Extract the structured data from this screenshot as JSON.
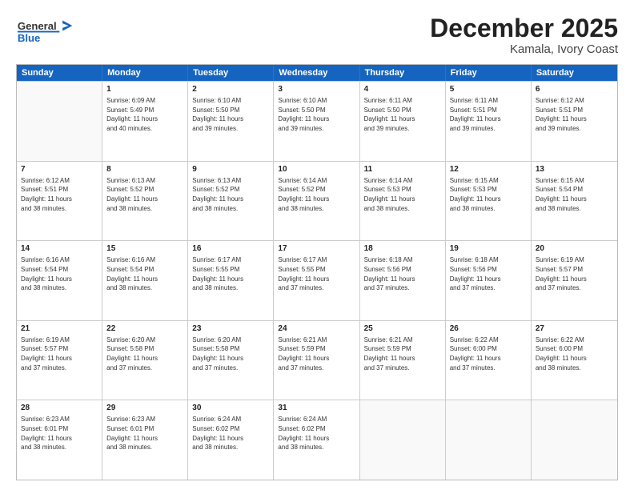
{
  "header": {
    "logo_general": "General",
    "logo_blue": "Blue",
    "month": "December 2025",
    "location": "Kamala, Ivory Coast"
  },
  "days_of_week": [
    "Sunday",
    "Monday",
    "Tuesday",
    "Wednesday",
    "Thursday",
    "Friday",
    "Saturday"
  ],
  "weeks": [
    [
      {
        "day": "",
        "info": ""
      },
      {
        "day": "1",
        "info": "Sunrise: 6:09 AM\nSunset: 5:49 PM\nDaylight: 11 hours\nand 40 minutes."
      },
      {
        "day": "2",
        "info": "Sunrise: 6:10 AM\nSunset: 5:50 PM\nDaylight: 11 hours\nand 39 minutes."
      },
      {
        "day": "3",
        "info": "Sunrise: 6:10 AM\nSunset: 5:50 PM\nDaylight: 11 hours\nand 39 minutes."
      },
      {
        "day": "4",
        "info": "Sunrise: 6:11 AM\nSunset: 5:50 PM\nDaylight: 11 hours\nand 39 minutes."
      },
      {
        "day": "5",
        "info": "Sunrise: 6:11 AM\nSunset: 5:51 PM\nDaylight: 11 hours\nand 39 minutes."
      },
      {
        "day": "6",
        "info": "Sunrise: 6:12 AM\nSunset: 5:51 PM\nDaylight: 11 hours\nand 39 minutes."
      }
    ],
    [
      {
        "day": "7",
        "info": "Sunrise: 6:12 AM\nSunset: 5:51 PM\nDaylight: 11 hours\nand 38 minutes."
      },
      {
        "day": "8",
        "info": "Sunrise: 6:13 AM\nSunset: 5:52 PM\nDaylight: 11 hours\nand 38 minutes."
      },
      {
        "day": "9",
        "info": "Sunrise: 6:13 AM\nSunset: 5:52 PM\nDaylight: 11 hours\nand 38 minutes."
      },
      {
        "day": "10",
        "info": "Sunrise: 6:14 AM\nSunset: 5:52 PM\nDaylight: 11 hours\nand 38 minutes."
      },
      {
        "day": "11",
        "info": "Sunrise: 6:14 AM\nSunset: 5:53 PM\nDaylight: 11 hours\nand 38 minutes."
      },
      {
        "day": "12",
        "info": "Sunrise: 6:15 AM\nSunset: 5:53 PM\nDaylight: 11 hours\nand 38 minutes."
      },
      {
        "day": "13",
        "info": "Sunrise: 6:15 AM\nSunset: 5:54 PM\nDaylight: 11 hours\nand 38 minutes."
      }
    ],
    [
      {
        "day": "14",
        "info": "Sunrise: 6:16 AM\nSunset: 5:54 PM\nDaylight: 11 hours\nand 38 minutes."
      },
      {
        "day": "15",
        "info": "Sunrise: 6:16 AM\nSunset: 5:54 PM\nDaylight: 11 hours\nand 38 minutes."
      },
      {
        "day": "16",
        "info": "Sunrise: 6:17 AM\nSunset: 5:55 PM\nDaylight: 11 hours\nand 38 minutes."
      },
      {
        "day": "17",
        "info": "Sunrise: 6:17 AM\nSunset: 5:55 PM\nDaylight: 11 hours\nand 37 minutes."
      },
      {
        "day": "18",
        "info": "Sunrise: 6:18 AM\nSunset: 5:56 PM\nDaylight: 11 hours\nand 37 minutes."
      },
      {
        "day": "19",
        "info": "Sunrise: 6:18 AM\nSunset: 5:56 PM\nDaylight: 11 hours\nand 37 minutes."
      },
      {
        "day": "20",
        "info": "Sunrise: 6:19 AM\nSunset: 5:57 PM\nDaylight: 11 hours\nand 37 minutes."
      }
    ],
    [
      {
        "day": "21",
        "info": "Sunrise: 6:19 AM\nSunset: 5:57 PM\nDaylight: 11 hours\nand 37 minutes."
      },
      {
        "day": "22",
        "info": "Sunrise: 6:20 AM\nSunset: 5:58 PM\nDaylight: 11 hours\nand 37 minutes."
      },
      {
        "day": "23",
        "info": "Sunrise: 6:20 AM\nSunset: 5:58 PM\nDaylight: 11 hours\nand 37 minutes."
      },
      {
        "day": "24",
        "info": "Sunrise: 6:21 AM\nSunset: 5:59 PM\nDaylight: 11 hours\nand 37 minutes."
      },
      {
        "day": "25",
        "info": "Sunrise: 6:21 AM\nSunset: 5:59 PM\nDaylight: 11 hours\nand 37 minutes."
      },
      {
        "day": "26",
        "info": "Sunrise: 6:22 AM\nSunset: 6:00 PM\nDaylight: 11 hours\nand 37 minutes."
      },
      {
        "day": "27",
        "info": "Sunrise: 6:22 AM\nSunset: 6:00 PM\nDaylight: 11 hours\nand 38 minutes."
      }
    ],
    [
      {
        "day": "28",
        "info": "Sunrise: 6:23 AM\nSunset: 6:01 PM\nDaylight: 11 hours\nand 38 minutes."
      },
      {
        "day": "29",
        "info": "Sunrise: 6:23 AM\nSunset: 6:01 PM\nDaylight: 11 hours\nand 38 minutes."
      },
      {
        "day": "30",
        "info": "Sunrise: 6:24 AM\nSunset: 6:02 PM\nDaylight: 11 hours\nand 38 minutes."
      },
      {
        "day": "31",
        "info": "Sunrise: 6:24 AM\nSunset: 6:02 PM\nDaylight: 11 hours\nand 38 minutes."
      },
      {
        "day": "",
        "info": ""
      },
      {
        "day": "",
        "info": ""
      },
      {
        "day": "",
        "info": ""
      }
    ]
  ]
}
